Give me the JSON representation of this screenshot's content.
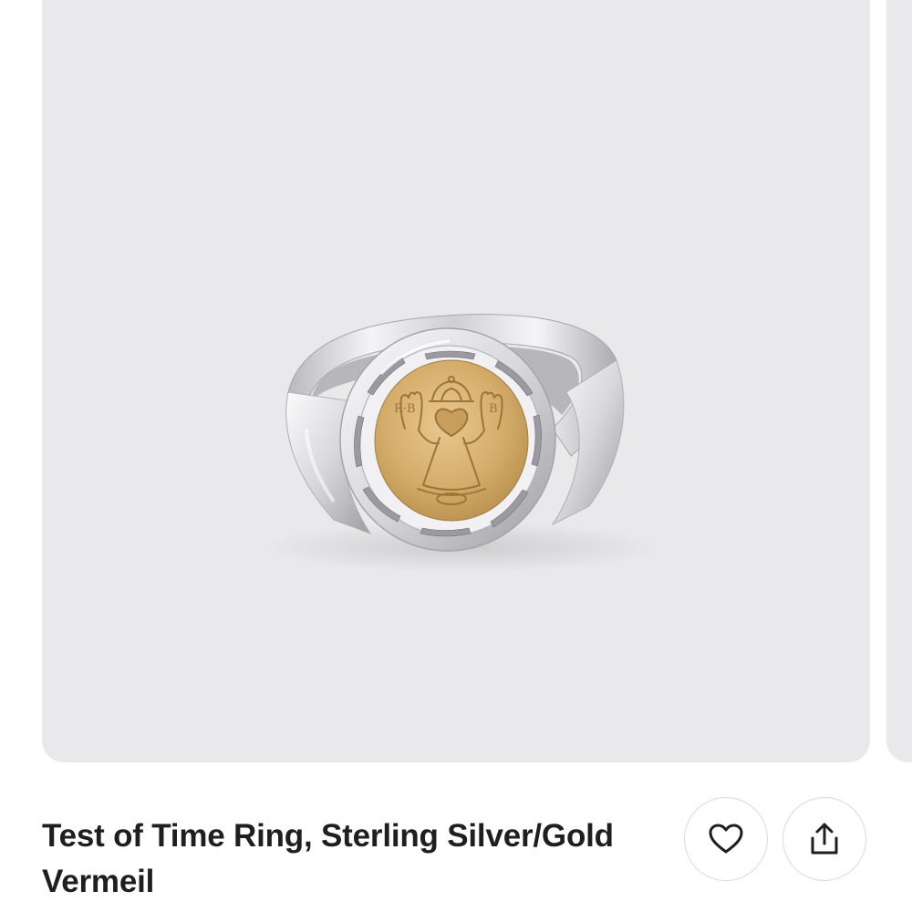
{
  "product": {
    "title": "Test of Time Ring, Sterling Silver/Gold Vermeil"
  },
  "gallery": {
    "main_image": "product-image-ring",
    "next_image": "product-image-next-peek",
    "background_color": "#e9e9eb"
  },
  "actions": {
    "favorite_icon": "heart-icon",
    "share_icon": "share-icon"
  }
}
